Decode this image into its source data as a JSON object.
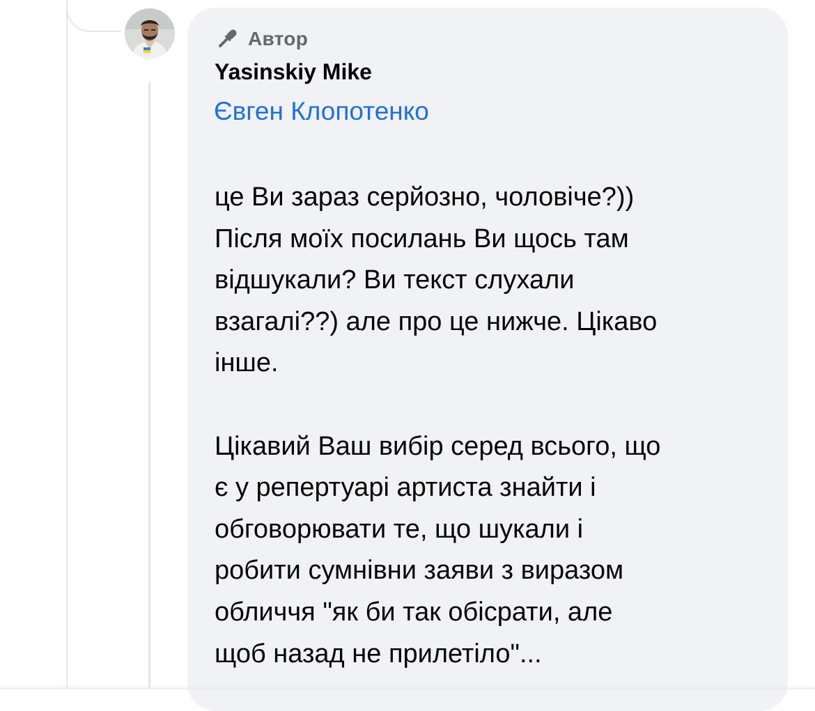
{
  "comment": {
    "badge_label": "Автор",
    "badge_icon": "microphone-icon",
    "author_name": "Yasinskiy Mike",
    "mention": "Євген Клопотенко",
    "paragraphs": [
      "це Ви зараз серйозно, чоловіче?))\nПісля моїх посилань Ви щось там\nвідшукали? Ви текст слухали\nвзагалі??) але про це нижче. Цікаво\nінше.",
      "Цікавий Ваш вибір серед всього, що\nє у репертуарі артиста знайти і\nобговорювати те, що шукали і\nробити сумнівни заяви з виразом\nобличчя \"як би так обісрати, але\nщоб назад не прилетіло\"..."
    ]
  },
  "colors": {
    "bubble_background": "#f0f2f5",
    "mention_link": "#216fdb",
    "secondary_text": "#65676b",
    "primary_text": "#050505",
    "thread_line": "#e4e6eb"
  }
}
